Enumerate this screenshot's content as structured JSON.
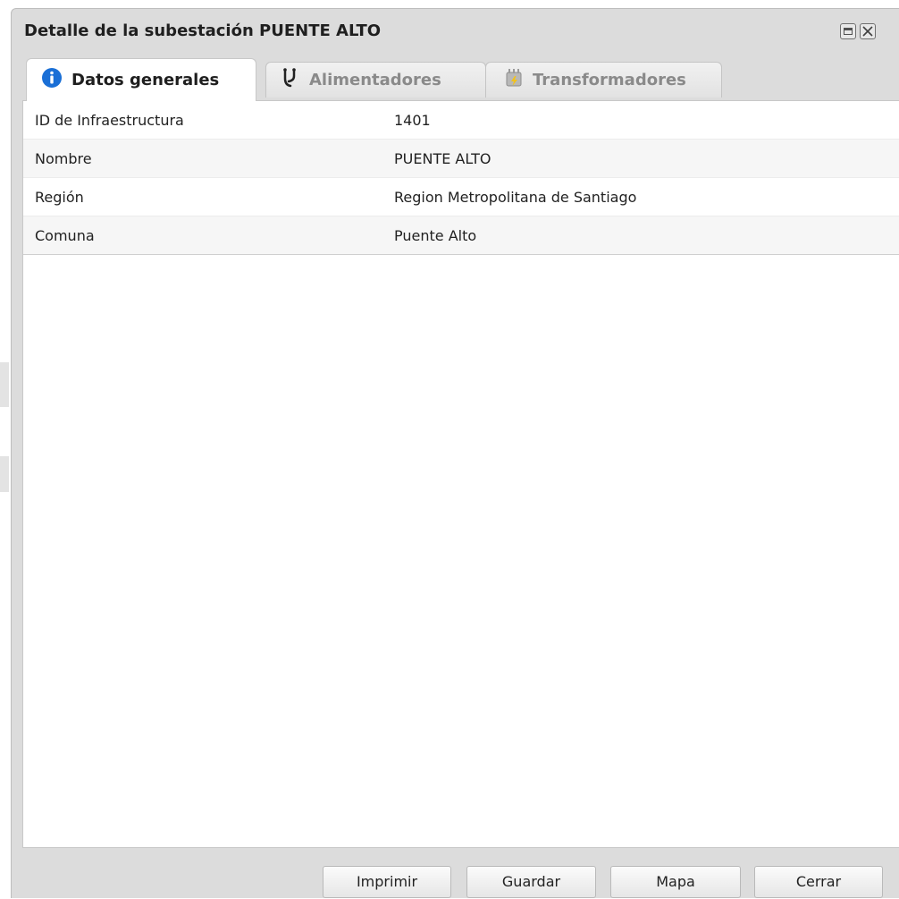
{
  "window": {
    "title": "Detalle de la subestación PUENTE ALTO"
  },
  "tabs": [
    {
      "label": "Datos generales",
      "icon": "info-icon",
      "active": true
    },
    {
      "label": "Alimentadores",
      "icon": "feeder-branch-icon",
      "active": false
    },
    {
      "label": "Transformadores",
      "icon": "transformer-icon",
      "active": false
    }
  ],
  "properties": [
    {
      "key": "ID de Infraestructura",
      "value": "1401"
    },
    {
      "key": "Nombre",
      "value": "PUENTE ALTO"
    },
    {
      "key": "Región",
      "value": "Region Metropolitana de Santiago"
    },
    {
      "key": "Comuna",
      "value": "Puente Alto"
    }
  ],
  "buttons": {
    "print": "Imprimir",
    "save": "Guardar",
    "map": "Mapa",
    "close": "Cerrar"
  },
  "colors": {
    "info_icon": "#1a6fd6",
    "window_bg": "#dcdcdc"
  }
}
